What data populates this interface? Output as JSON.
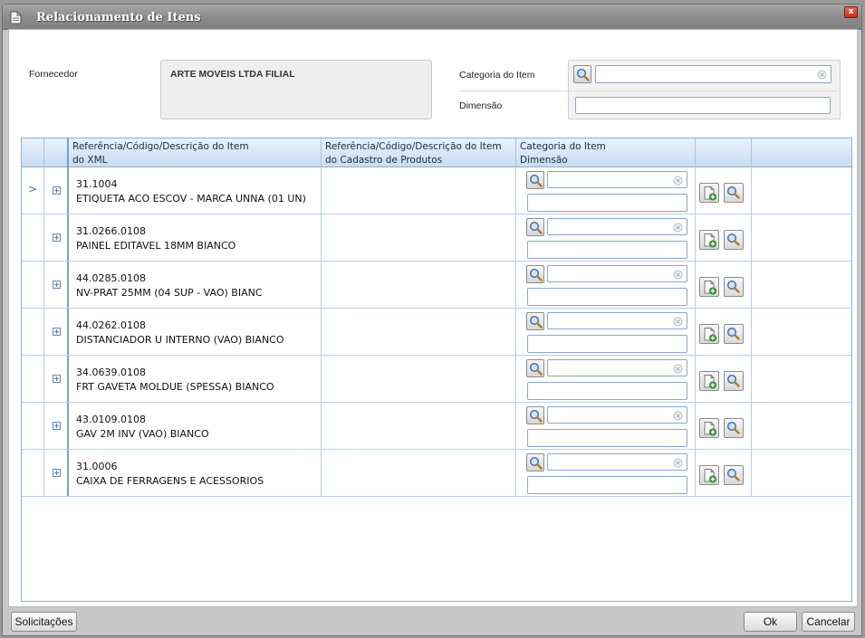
{
  "window": {
    "title": "Relacionamento de Itens",
    "close_label": "x"
  },
  "form": {
    "supplier_label": "Fornecedor",
    "supplier_value": "ARTE MOVEIS LTDA FILIAL",
    "category_label": "Categoria do Item",
    "category_value": "",
    "dimension_label": "Dimensão",
    "dimension_value": ""
  },
  "grid": {
    "headers": [
      {
        "line1": "Referência/Código/Descrição do Item",
        "line2": "do XML"
      },
      {
        "line1": "Referência/Código/Descrição do Item",
        "line2": "do Cadastro de Produtos"
      },
      {
        "line1": "Categoria do Item",
        "line2": "Dimensão"
      }
    ],
    "row_indicator": ">",
    "expander_glyph": "+",
    "rows": [
      {
        "code": "31.1004",
        "description": "ETIQUETA ACO ESCOV - MARCA UNNA (01 UN)",
        "product": "",
        "category": "",
        "dimension": ""
      },
      {
        "code": "31.0266.0108",
        "description": "PAINEL EDITAVEL 18MM BIANCO",
        "product": "",
        "category": "",
        "dimension": ""
      },
      {
        "code": "44.0285.0108",
        "description": "NV-PRAT 25MM (04 SUP - VAO) BIANC",
        "product": "",
        "category": "",
        "dimension": ""
      },
      {
        "code": "44.0262.0108",
        "description": "DISTANCIADOR U INTERNO (VAO) BIANCO",
        "product": "",
        "category": "",
        "dimension": ""
      },
      {
        "code": "34.0639.0108",
        "description": "FRT GAVETA MOLDUE (SPESSA) BIANCO",
        "product": "",
        "category": "",
        "dimension": ""
      },
      {
        "code": "43.0109.0108",
        "description": "GAV 2M INV (VAO) BIANCO",
        "product": "",
        "category": "",
        "dimension": ""
      },
      {
        "code": "31.0006",
        "description": "CAIXA DE FERRAGENS E ACESSORIOS",
        "product": "",
        "category": "",
        "dimension": ""
      }
    ]
  },
  "footer": {
    "requests_button": "Solicitações",
    "ok_button": "Ok",
    "cancel_button": "Cancelar"
  },
  "icons": {
    "search": "magnifier-icon",
    "clear": "clear-circle-icon",
    "add": "new-document-plus-icon",
    "expand": "plus-box-icon"
  },
  "colors": {
    "grid_header": "#c9dcf0",
    "grid_border": "#8eb0d6",
    "field_border": "#8aa7c7",
    "close_red": "#c0301e"
  }
}
